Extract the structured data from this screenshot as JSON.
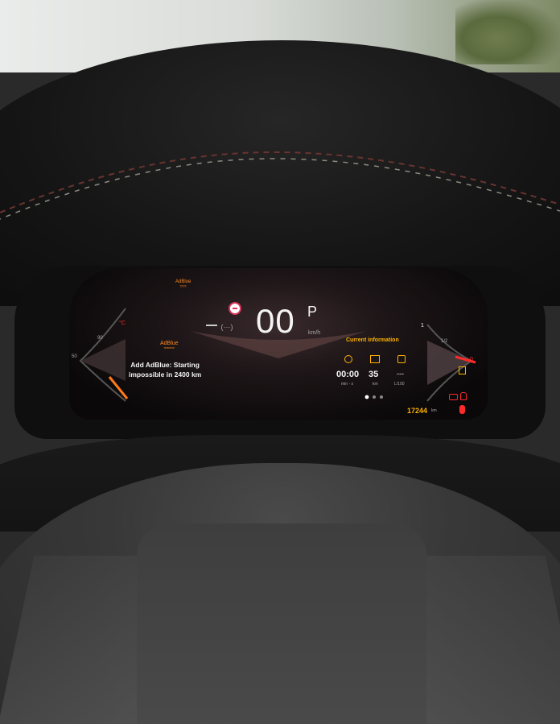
{
  "cluster": {
    "top_warning": {
      "label": "AdBlue",
      "sub": "≈≈≈"
    },
    "speed": {
      "value": "00",
      "unit": "km/h",
      "gear": "P"
    },
    "left_gauge": {
      "tick_90": "90",
      "tick_50": "50",
      "temp_unit": "°C"
    },
    "message": {
      "icon_label": "AdBlue",
      "icon_sub": "≈≈≈≈",
      "text_line1": "Add AdBlue: Starting",
      "text_line2": "impossible in 2400 km"
    },
    "trip": {
      "title": "Current information",
      "time_value": "00:00",
      "time_unit": "min - s",
      "distance_value": "35",
      "distance_unit": "km",
      "consumption_value": "---",
      "consumption_unit": "L/100"
    },
    "right_gauge": {
      "tick_1": "1",
      "tick_half": "1/2",
      "tick_0": "0"
    },
    "odometer": {
      "value": "17244",
      "unit": "km"
    },
    "driver_assist": {
      "text": "(···)"
    },
    "colors": {
      "warning": "#ff8a1f",
      "info": "#ffb400",
      "alert": "#ff2a2a"
    }
  }
}
